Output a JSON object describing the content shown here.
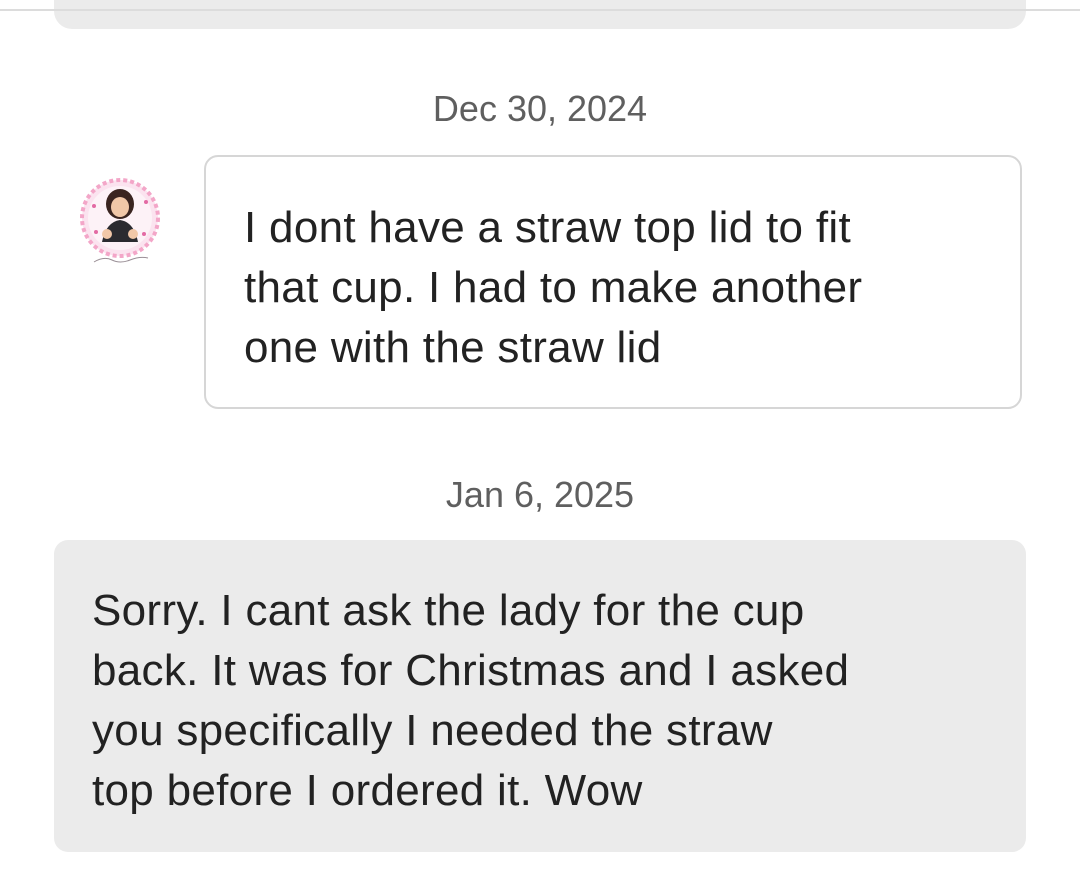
{
  "conversation": {
    "messages": [
      {
        "date": "Dec 30, 2024",
        "sender": "other",
        "text": "I dont have a straw top lid to fit\nthat cup. I had to make another\none with the straw lid"
      },
      {
        "date": "Jan 6, 2025",
        "sender": "me",
        "text": "Sorry. I cant ask the lady for the cup\nback. It was for Christmas and I asked\nyou specifically I needed the straw\ntop before I ordered it. Wow"
      }
    ]
  },
  "colors": {
    "background": "#ffffff",
    "sent_bubble": "#ebebeb",
    "received_bubble_border": "#d6d6d6",
    "date_text": "#5f5f5f",
    "message_text": "#222222",
    "avatar_ring": "#f3a6c8"
  }
}
